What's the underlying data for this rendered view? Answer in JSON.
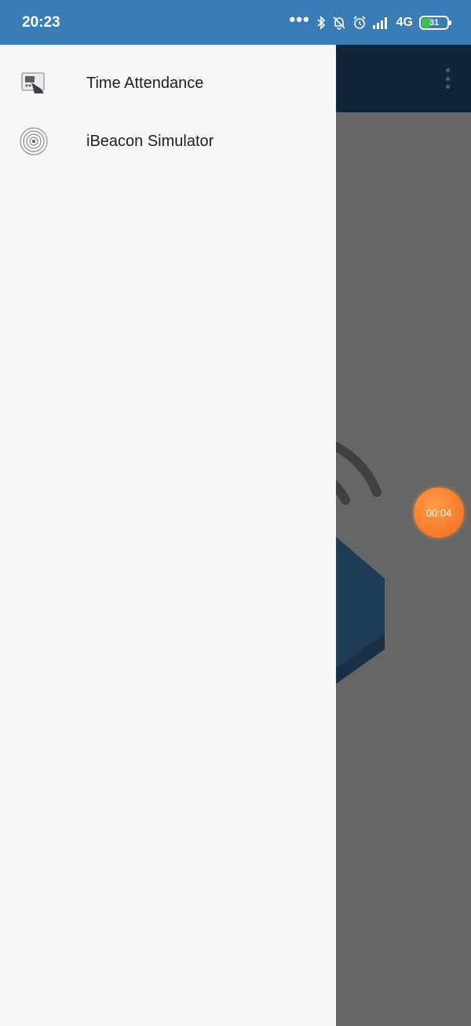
{
  "status_bar": {
    "time": "20:23",
    "network": "4G",
    "battery": "31",
    "icons": [
      "more-dots-icon",
      "bluetooth-icon",
      "notifications-off-icon",
      "alarm-icon",
      "signal-icon",
      "battery-icon"
    ]
  },
  "drawer": {
    "items": [
      {
        "label": "Time Attendance",
        "icon": "time-attendance-icon"
      },
      {
        "label": "iBeacon Simulator",
        "icon": "beacon-icon"
      }
    ]
  },
  "background_app": {
    "device_id_fragment": "a9ffa6"
  },
  "timer": {
    "value": "00:04"
  },
  "colors": {
    "status_bar": "#3a7db6",
    "toolbar": "#2a5a8a",
    "drawer": "#f7f8f6",
    "timer": "#f47a2a"
  }
}
